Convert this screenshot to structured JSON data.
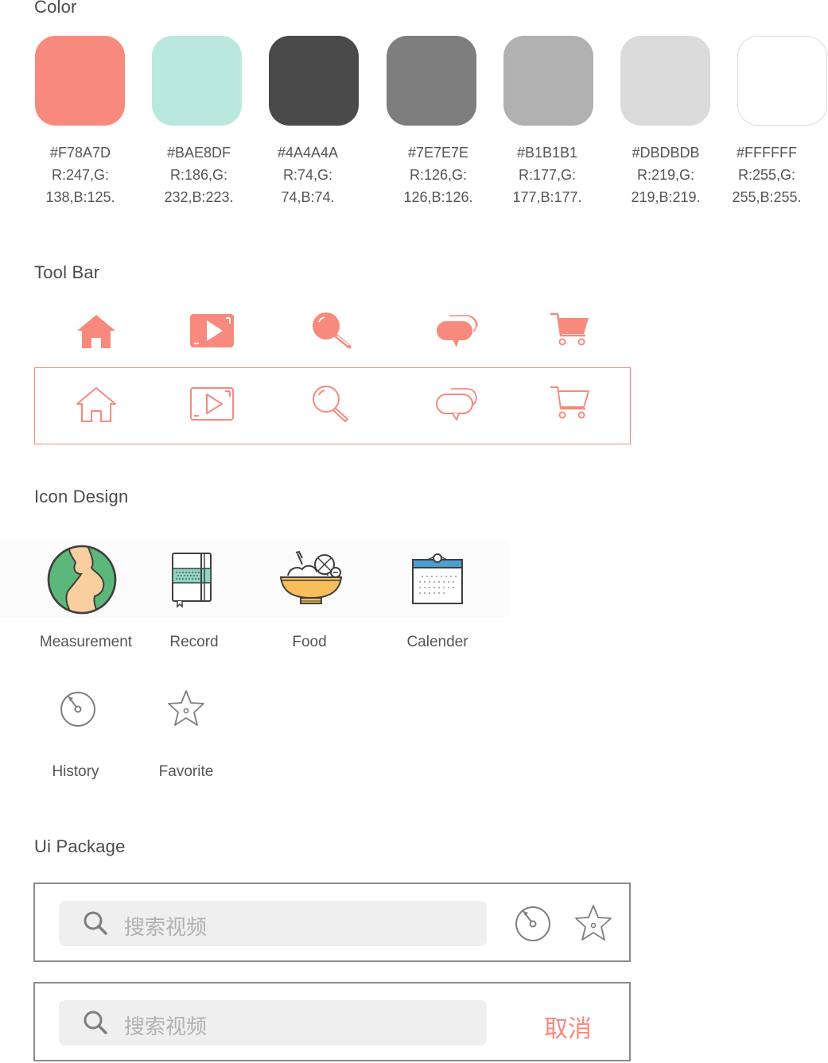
{
  "sections": {
    "color": "Color",
    "toolbar": "Tool Bar",
    "icon_design": "Icon Design",
    "ui_package": "Ui Package"
  },
  "colors": [
    {
      "hex": "#F78A7D",
      "l1": "#F78A7D",
      "l2": "R:247,G:",
      "l3": "138,B:125."
    },
    {
      "hex": "#BAE8DF",
      "l1": "#BAE8DF",
      "l2": "R:186,G:",
      "l3": "232,B:223."
    },
    {
      "hex": "#4A4A4A",
      "l1": "#4A4A4A",
      "l2": "R:74,G:",
      "l3": "74,B:74."
    },
    {
      "hex": "#7E7E7E",
      "l1": "#7E7E7E",
      "l2": "R:126,G:",
      "l3": "126,B:126."
    },
    {
      "hex": "#B1B1B1",
      "l1": "#B1B1B1",
      "l2": "R:177,G:",
      "l3": "177,B:177."
    },
    {
      "hex": "#DBDBDB",
      "l1": "#DBDBDB",
      "l2": "R:219,G:",
      "l3": "219,B:219."
    },
    {
      "hex": "#FFFFFF",
      "l1": "#FFFFFF",
      "l2": "R:255,G:",
      "l3": "255,B:255."
    }
  ],
  "toolbar_icons": [
    "home-icon",
    "video-icon",
    "search-icon",
    "chat-icon",
    "cart-icon"
  ],
  "accent": "#F78A7D",
  "icon_design": {
    "labels": {
      "measurement": "Measurement",
      "record": "Record",
      "food": "Food",
      "calender": "Calender",
      "history": "History",
      "favorite": "Favorite"
    }
  },
  "ui_package": {
    "search_placeholder_1": "搜索视频",
    "search_placeholder_2": "搜索视频",
    "cancel_label": "取消"
  }
}
